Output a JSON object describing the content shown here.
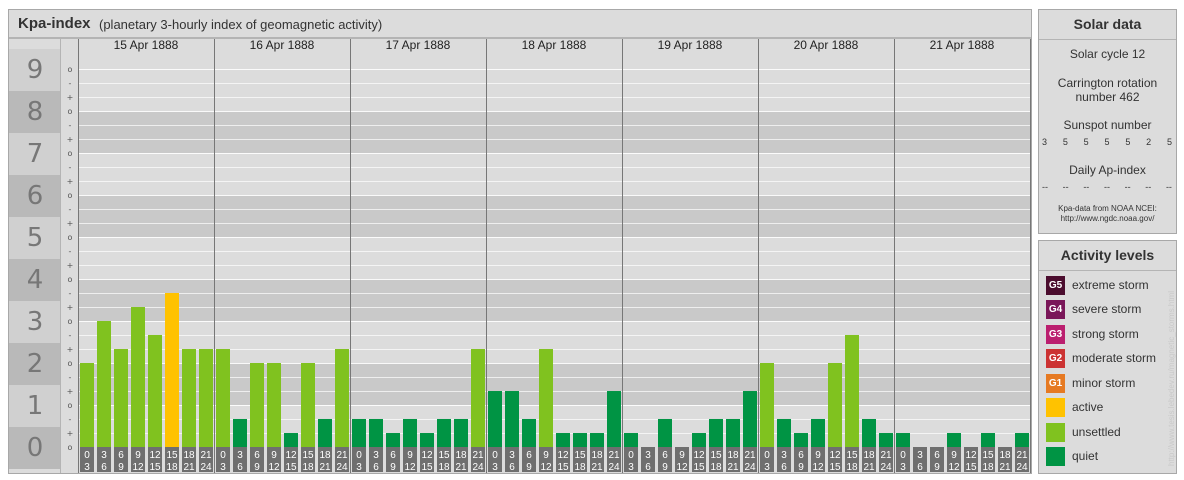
{
  "header": {
    "title": "Kpa-index",
    "subtitle": "(planetary 3-hourly index of geomagnetic activity)"
  },
  "chart_data": {
    "type": "bar",
    "title": "Kpa-index",
    "subtitle": "(planetary 3-hourly index of geomagnetic activity)",
    "ylim": [
      0,
      9
    ],
    "y_major_ticks": [
      "0",
      "1",
      "2",
      "3",
      "4",
      "5",
      "6",
      "7",
      "8",
      "9"
    ],
    "y_minor_ticks": [
      "-",
      "o",
      "+"
    ],
    "days": [
      "15 Apr 1888",
      "16 Apr 1888",
      "17 Apr 1888",
      "18 Apr 1888",
      "19 Apr 1888",
      "20 Apr 1888",
      "21 Apr 1888"
    ],
    "hour_labels": [
      [
        "0",
        "3"
      ],
      [
        "3",
        "6"
      ],
      [
        "6",
        "9"
      ],
      [
        "9",
        "12"
      ],
      [
        "12",
        "15"
      ],
      [
        "15",
        "18"
      ],
      [
        "18",
        "21"
      ],
      [
        "21",
        "24"
      ]
    ],
    "values": [
      [
        2.0,
        3.0,
        2.333,
        3.333,
        2.667,
        3.667,
        2.333,
        2.333
      ],
      [
        2.333,
        0.667,
        2.0,
        2.0,
        0.333,
        2.0,
        0.667,
        2.333
      ],
      [
        0.667,
        0.667,
        0.333,
        0.667,
        0.333,
        0.667,
        0.667,
        2.333
      ],
      [
        1.333,
        1.333,
        0.667,
        2.333,
        0.333,
        0.333,
        0.333,
        1.333
      ],
      [
        0.333,
        0.0,
        0.667,
        0.0,
        0.333,
        0.667,
        0.667,
        1.333
      ],
      [
        2.0,
        0.667,
        0.333,
        0.667,
        2.0,
        2.667,
        0.667,
        0.333
      ],
      [
        0.333,
        0.0,
        0.0,
        0.333,
        0.0,
        0.333,
        0.0,
        0.333
      ]
    ],
    "levels": [
      [
        1,
        1,
        1,
        1,
        1,
        2,
        1,
        1
      ],
      [
        1,
        0,
        1,
        1,
        0,
        1,
        0,
        1
      ],
      [
        0,
        0,
        0,
        0,
        0,
        0,
        0,
        1
      ],
      [
        0,
        0,
        0,
        1,
        0,
        0,
        0,
        0
      ],
      [
        0,
        0,
        0,
        0,
        0,
        0,
        0,
        0
      ],
      [
        1,
        0,
        0,
        0,
        1,
        1,
        0,
        0
      ],
      [
        0,
        0,
        0,
        0,
        0,
        0,
        0,
        0
      ]
    ],
    "level_colors": [
      "#009444",
      "#80c21f",
      "#ffc200",
      "#e67a23",
      "#cc3333",
      "#bb1f6f",
      "#7a1759",
      "#4b0d2e"
    ]
  },
  "solar": {
    "title": "Solar data",
    "cycle": "Solar cycle 12",
    "carrington_line1": "Carrington rotation",
    "carrington_line2": "number 462",
    "sunspot_label": "Sunspot number",
    "sunspot_values": [
      "3",
      "5",
      "5",
      "5",
      "5",
      "2",
      "5"
    ],
    "ap_label": "Daily Ap-index",
    "ap_values": [
      "--",
      "--",
      "--",
      "--",
      "--",
      "--",
      "--"
    ],
    "source_line1": "Kpa-data from NOAA NCEI:",
    "source_line2": "http://www.ngdc.noaa.gov/"
  },
  "activity": {
    "title": "Activity levels",
    "items": [
      {
        "code": "G5",
        "label": "extreme storm",
        "color": "#4b0d2e"
      },
      {
        "code": "G4",
        "label": "severe storm",
        "color": "#7a1759"
      },
      {
        "code": "G3",
        "label": "strong storm",
        "color": "#bb1f6f"
      },
      {
        "code": "G2",
        "label": "moderate storm",
        "color": "#cc3333"
      },
      {
        "code": "G1",
        "label": "minor storm",
        "color": "#e67a23"
      },
      {
        "code": "",
        "label": "active",
        "color": "#ffc200"
      },
      {
        "code": "",
        "label": "unsettled",
        "color": "#80c21f"
      },
      {
        "code": "",
        "label": "quiet",
        "color": "#009444"
      }
    ]
  },
  "watermark": "http://www.tesis.lebedev.ru/magnetic_storms.html"
}
